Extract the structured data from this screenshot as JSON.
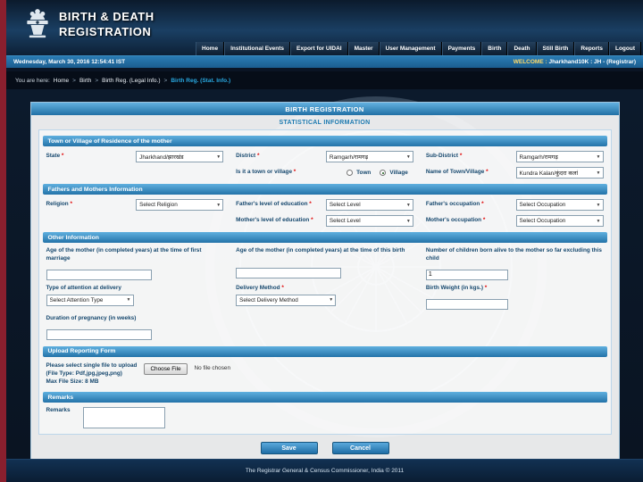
{
  "icons": {
    "emblem": "ashoka-emblem",
    "dropdown": "▼"
  },
  "header": {
    "title_line1": "BIRTH & DEATH",
    "title_line2": "REGISTRATION"
  },
  "nav": {
    "items": [
      "Home",
      "Institutional Events",
      "Export for UIDAI",
      "Master",
      "User Management",
      "Payments",
      "Birth",
      "Death",
      "Still Birth",
      "Reports",
      "Logout"
    ]
  },
  "statusbar": {
    "datetime": "Wednesday, March 30, 2016 12:54:41 IST",
    "welcome_label": "WELCOME :",
    "welcome_user": "Jharkhand10K : JH - (Registrar)"
  },
  "breadcrumb": {
    "prefix": "You are here:",
    "sep": ">",
    "home": "Home",
    "birth": "Birth",
    "legal": "Birth Reg. (Legal Info.)",
    "stat": "Birth Reg. (Stat. Info.)"
  },
  "form": {
    "title": "BIRTH REGISTRATION",
    "subtitle": "STATISTICAL INFORMATION",
    "required_mark": "*",
    "section1": {
      "title": "Town or Village of Residence of the mother",
      "state_label": "State",
      "state_value": "Jharkhand/झारखंड",
      "district_label": "District",
      "district_value": "Ramgarh/रामगढ़",
      "subdistrict_label": "Sub-District",
      "subdistrict_value": "Ramgarh/रामगढ़",
      "town_village_label": "Is it a town or village",
      "town_option": "Town",
      "village_option": "Village",
      "town_name_label": "Name of Town/Village",
      "town_name_value": "Kundra Kalan/कुंदरा कलां"
    },
    "section2": {
      "title": "Fathers and Mothers Information",
      "religion_label": "Religion",
      "religion_value": "Select Religion",
      "father_edu_label": "Father's level of education",
      "father_edu_value": "Select Level",
      "father_occ_label": "Father's occupation",
      "father_occ_value": "Select Occupation",
      "mother_edu_label": "Mother's level of education",
      "mother_edu_value": "Select Level",
      "mother_occ_label": "Mother's occupation",
      "mother_occ_value": "Select Occupation"
    },
    "section3": {
      "title": "Other Information",
      "age_marriage_label": "Age of the mother (in completed years) at the time of first marriage",
      "age_birth_label": "Age of the mother (in completed years) at the time of this birth",
      "children_label": "Number of children born alive to the mother so far excluding this child",
      "children_value": "1",
      "attention_label": "Type of attention at delivery",
      "attention_value": "Select Attention Type",
      "delivery_label": "Delivery Method",
      "delivery_value": "Select Delivery Method",
      "weight_label": "Birth Weight (in kgs.)",
      "pregnancy_label": "Duration of pregnancy (in weeks)"
    },
    "section4": {
      "title": "Upload Reporting Form",
      "instruction_line1": "Please select single file to upload",
      "instruction_line2": "(File Type: Pdf,jpg,jpeg,png)",
      "instruction_line3": "Max File Size: 8 MB",
      "choose_file_label": "Choose File",
      "no_file_text": "No file chosen"
    },
    "section5": {
      "title": "Remarks",
      "remarks_label": "Remarks"
    },
    "buttons": {
      "save": "Save",
      "cancel": "Cancel"
    }
  },
  "footer": {
    "text": "The Registrar General & Census Commissioner, India © 2011"
  }
}
